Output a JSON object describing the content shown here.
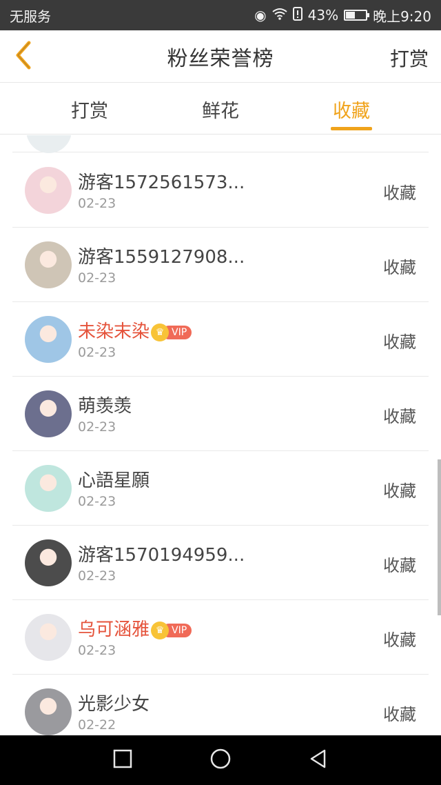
{
  "status_bar": {
    "carrier": "无服务",
    "battery": "43%",
    "time": "晚上9:20"
  },
  "nav": {
    "title": "粉丝荣誉榜",
    "right_action": "打赏"
  },
  "tabs": [
    {
      "label": "打赏",
      "active": false
    },
    {
      "label": "鲜花",
      "active": false
    },
    {
      "label": "收藏",
      "active": true
    }
  ],
  "colors": {
    "accent": "#f0a31b",
    "vip_name": "#e5533b",
    "vip_tag": "#f06a57"
  },
  "vip_label": "VIP",
  "rows": [
    {
      "name": "游客1572561573...",
      "date": "02-23",
      "action": "收藏",
      "vip": false,
      "avatar": "#f3d4da"
    },
    {
      "name": "游客1559127908...",
      "date": "02-23",
      "action": "收藏",
      "vip": false,
      "avatar": "#cfc5b6"
    },
    {
      "name": "未染末染",
      "date": "02-23",
      "action": "收藏",
      "vip": true,
      "avatar": "#9fc6e6"
    },
    {
      "name": "萌羡羡",
      "date": "02-23",
      "action": "收藏",
      "vip": false,
      "avatar": "#6c6f8e"
    },
    {
      "name": "心語星願",
      "date": "02-23",
      "action": "收藏",
      "vip": false,
      "avatar": "#bfe6de"
    },
    {
      "name": "游客1570194959...",
      "date": "02-23",
      "action": "收藏",
      "vip": false,
      "avatar": "#4c4c4c"
    },
    {
      "name": "乌可涵雅",
      "date": "02-23",
      "action": "收藏",
      "vip": true,
      "avatar": "#e6e6ea"
    },
    {
      "name": "光影少女",
      "date": "02-22",
      "action": "收藏",
      "vip": false,
      "avatar": "#9a9a9e"
    }
  ]
}
